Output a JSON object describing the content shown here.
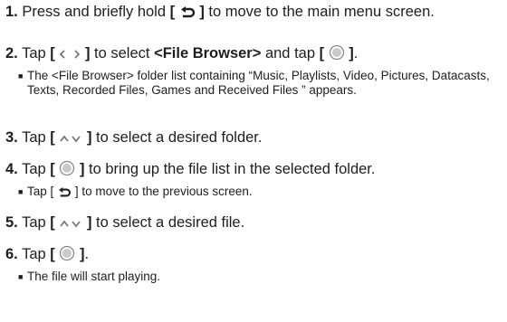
{
  "steps": [
    {
      "number": "1.",
      "text_a": "Press and briefly hold ",
      "icon": "back-arrow-icon",
      "text_b": " to move to the main menu screen."
    },
    {
      "number": "2.",
      "text_a": "Tap ",
      "icon": "left-right-arrows-icon",
      "text_b": " to select ",
      "bold": "<File Browser>",
      "text_c": " and tap ",
      "icon2": "select-button-icon",
      "text_d": ".",
      "note": "The <File Browser> folder list containing “Music, Playlists, Video, Pictures, Datacasts, Texts, Recorded Files, Games and Received Files ” appears."
    },
    {
      "number": "3.",
      "text_a": "Tap ",
      "icon": "up-down-arrows-icon",
      "text_b": " to select a desired folder."
    },
    {
      "number": "4.",
      "text_a": "Tap ",
      "icon": "select-button-icon",
      "text_b": " to bring up the file list in the selected folder.",
      "note_a": "Tap [",
      "note_icon": "back-arrow-icon",
      "note_b": "] to move to the previous screen."
    },
    {
      "number": "5.",
      "text_a": "Tap ",
      "icon": "up-down-arrows-icon",
      "text_b": " to select a desired file."
    },
    {
      "number": "6.",
      "text_a": "Tap ",
      "icon": "select-button-icon",
      "text_b": ".",
      "note": "The file will start playing."
    }
  ],
  "bullet_char": "■",
  "bracket_open": "[",
  "bracket_close": "]"
}
